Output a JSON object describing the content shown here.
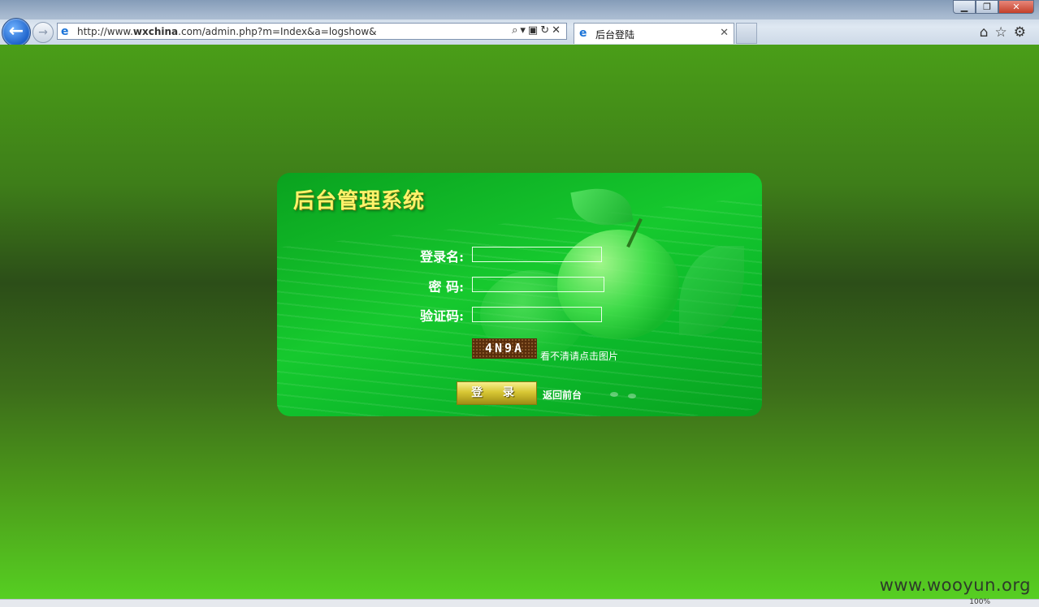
{
  "browser": {
    "url_prefix": "http://www.",
    "url_host": "wxchina",
    "url_suffix": ".com/admin.php?m=Index&a=logshow&",
    "tab_title": "后台登陆",
    "icons": [
      "back-arrow-icon",
      "forward-arrow-icon",
      "ie-logo-icon",
      "search-icon",
      "compat-view-icon",
      "refresh-icon",
      "stop-icon",
      "home-icon",
      "star-icon",
      "gear-icon"
    ],
    "window_controls": [
      "minimize",
      "restore",
      "close"
    ]
  },
  "login": {
    "panel_title": "后台管理系统",
    "username_label": "登录名:",
    "username_value": "",
    "password_label": "密 码:",
    "password_value": "",
    "captcha_label": "验证码:",
    "captcha_value": "",
    "captcha_image_text": "4N9A",
    "captcha_hint": "看不清请点击图片",
    "login_button": "登 录",
    "back_link": "返回前台"
  },
  "status": {
    "zoom": "100%"
  },
  "watermark": "www.wooyun.org",
  "colors": {
    "page_green": "#4a9a1a",
    "panel_green": "#16c92e",
    "title_yellow": "#fff36b",
    "button_gold": "#d8c734",
    "captcha_brown": "#5a2e0c"
  }
}
